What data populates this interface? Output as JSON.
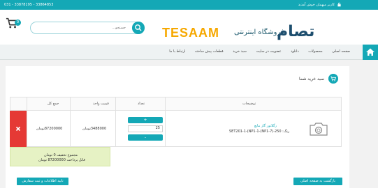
{
  "topbar": {
    "phone": "031 - 33878195 - 33864853",
    "welcome": "کاربر میهمان خوش آمدید"
  },
  "header": {
    "cart_count": "0",
    "search_placeholder": "جستجو...",
    "logo_latin": "TESAAM",
    "logo_store": "فروشگاه اینترنتی",
    "logo_mark": "تصام"
  },
  "nav": {
    "items": [
      "صفحه اصلی",
      "محصولات",
      "دانلود",
      "عضویت در سایت",
      "سبد خرید",
      "قطعات پیش ساخته",
      "ارتباط با ما"
    ]
  },
  "cart": {
    "title": "سبد خرید شما",
    "columns": {
      "description": "توضیحات",
      "quantity": "تعداد",
      "unit_price": "قیمت واحد",
      "total": "جمع کل"
    },
    "item": {
      "name": "رگلاتور گاز مایع",
      "desc_line1": "SET201-1-(NP1-1-(NP1-7)-250 :رنگ",
      "quantity": "25",
      "unit_price": "3488000تومان",
      "total": "87200000تومان",
      "plus": "+",
      "minus": "-",
      "remove": "×"
    },
    "summary": {
      "discount": "مجموع تخفیف 0 تومان",
      "payable": "قابل پرداخت 87200000 تومان"
    },
    "buttons": {
      "back": "بازگشت به صفحه اصلی",
      "confirm": "تایید اطلاعات و ثبت سفارش"
    }
  },
  "colors": {
    "accent": "#14a8b6",
    "danger": "#e53935",
    "logo_orange": "#f6a800",
    "logo_blue": "#1d4e6e"
  }
}
